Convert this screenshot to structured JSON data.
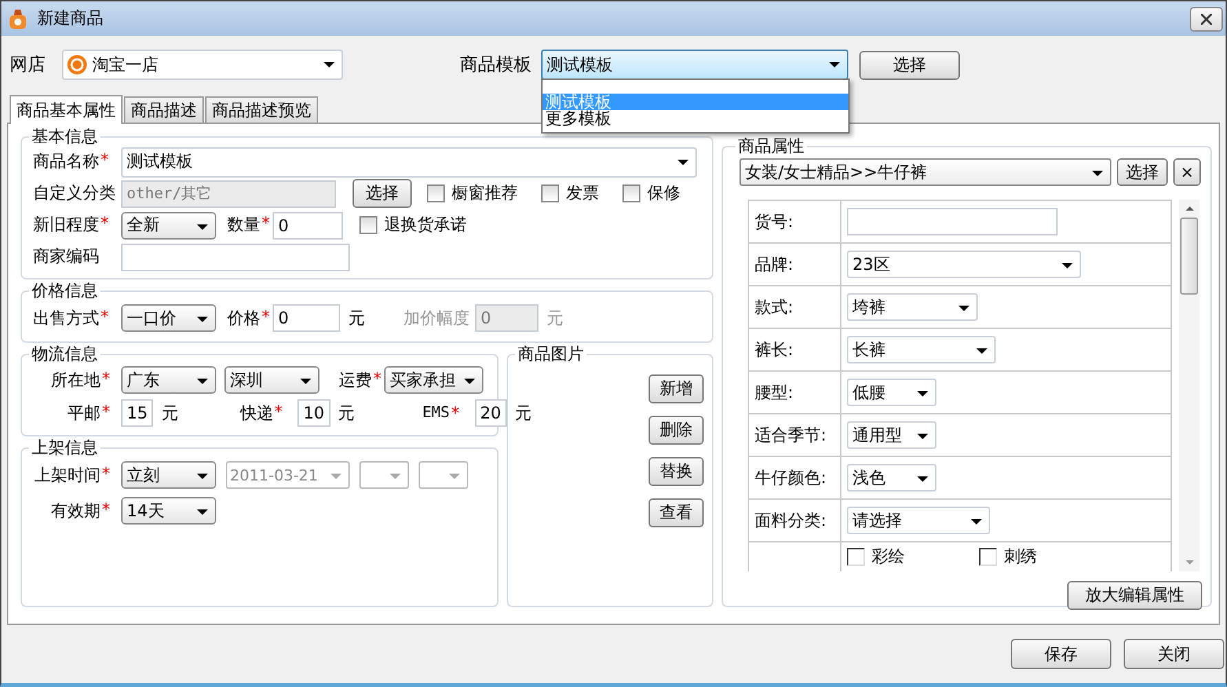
{
  "window": {
    "title": "新建商品"
  },
  "shop": {
    "label": "网店",
    "value": "淘宝一店"
  },
  "template": {
    "label": "商品模板",
    "value": "测试模板",
    "button": "选择",
    "dropdown": [
      {
        "label": "测试模板",
        "selected": true
      },
      {
        "label": "更多模板",
        "selected": false
      }
    ]
  },
  "tabs": [
    {
      "label": "商品基本属性",
      "selected": true
    },
    {
      "label": "商品描述",
      "selected": false
    },
    {
      "label": "商品描述预览",
      "selected": false
    }
  ],
  "basic_info": {
    "title": "基本信息",
    "name": {
      "label": "商品名称",
      "mark": "*",
      "value": "测试模板"
    },
    "category": {
      "label": "自定义分类",
      "value": "other/其它",
      "disabled": true,
      "button": "选择"
    },
    "options": [
      {
        "label": "橱窗推荐",
        "checked": false
      },
      {
        "label": "发票",
        "checked": false
      },
      {
        "label": "保修",
        "checked": false
      }
    ],
    "condition": {
      "label": "新旧程度",
      "mark": "*",
      "value": "全新"
    },
    "quantity": {
      "label": "数量",
      "mark": "*",
      "value": "0"
    },
    "return_promise": {
      "label": "退换货承诺",
      "checked": false
    },
    "merchant_code": {
      "label": "商家编码"
    }
  },
  "price_info": {
    "title": "价格信息",
    "sale_method": {
      "label": "出售方式",
      "mark": "*",
      "value": "一口价"
    },
    "price": {
      "label": "价格",
      "mark": "*",
      "value": "0",
      "unit": "元"
    },
    "increment": {
      "label": "加价幅度",
      "value": "0",
      "unit": "元",
      "disabled": true
    }
  },
  "logistics": {
    "title": "物流信息",
    "location": {
      "label": "所在地",
      "mark": "*",
      "province": "广东",
      "city": "深圳"
    },
    "freight": {
      "label": "运费",
      "mark": "*",
      "value": "买家承担"
    },
    "fees": [
      {
        "label": "平邮",
        "mark": "*",
        "value": "15",
        "unit": "元"
      },
      {
        "label": "快递",
        "mark": "*",
        "value": "10",
        "unit": "元"
      },
      {
        "label": "EMS",
        "mark": "*",
        "value": "20",
        "unit": "元"
      }
    ]
  },
  "listing": {
    "title": "上架信息",
    "time": {
      "label": "上架时间",
      "mark": "*",
      "value": "立刻",
      "date": "2011-03-21",
      "disabled": true
    },
    "validity": {
      "label": "有效期",
      "mark": "*",
      "value": "14天"
    }
  },
  "images": {
    "title": "商品图片",
    "buttons": [
      "新增",
      "删除",
      "替换",
      "查看"
    ]
  },
  "attributes": {
    "title": "商品属性",
    "category": "女装/女士精品>>牛仔裤",
    "button": "选择",
    "clear": "×",
    "rows": [
      {
        "label": "货号:",
        "kind": "text"
      },
      {
        "label": "品牌:",
        "kind": "select",
        "value": "23区"
      },
      {
        "label": "款式:",
        "kind": "select",
        "value": "垮裤"
      },
      {
        "label": "裤长:",
        "kind": "select",
        "value": "长裤"
      },
      {
        "label": "腰型:",
        "kind": "select",
        "value": "低腰"
      },
      {
        "label": "适合季节:",
        "kind": "select",
        "value": "通用型"
      },
      {
        "label": "牛仔颜色:",
        "kind": "select",
        "value": "浅色"
      },
      {
        "label": "面料分类:",
        "kind": "select",
        "value": "请选择"
      },
      {
        "kind": "checkboxes",
        "options": [
          {
            "label": "彩绘",
            "checked": false
          },
          {
            "label": "刺绣",
            "checked": false
          }
        ]
      }
    ]
  },
  "enlarge_button": "放大编辑属性",
  "buttons": [
    "保存",
    "关闭"
  ]
}
